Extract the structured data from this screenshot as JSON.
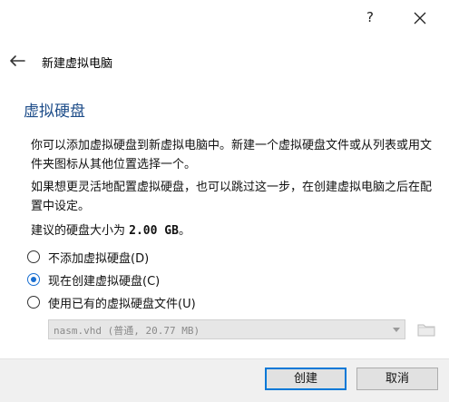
{
  "titlebar": {
    "help_label": "?"
  },
  "header": {
    "title": "新建虚拟电脑"
  },
  "page": {
    "title": "虚拟硬盘",
    "para1": "你可以添加虚拟硬盘到新虚拟电脑中。新建一个虚拟硬盘文件或从列表或用文件夹图标从其他位置选择一个。",
    "para2": "如果想更灵活地配置虚拟硬盘，也可以跳过这一步，在创建虚拟电脑之后在配置中设定。",
    "size_prefix": "建议的硬盘大小为",
    "size_value": "2.00 GB",
    "size_suffix": "。"
  },
  "options": [
    {
      "label": "不添加虚拟硬盘(D)",
      "checked": false
    },
    {
      "label": "现在创建虚拟硬盘(C)",
      "checked": true
    },
    {
      "label": "使用已有的虚拟硬盘文件(U)",
      "checked": false
    }
  ],
  "existing_disk": {
    "selected": "nasm.vhd (普通, 20.77 MB)"
  },
  "buttons": {
    "create": "创建",
    "cancel": "取消"
  },
  "icons": {
    "back": "back-arrow-icon",
    "close": "close-icon",
    "folder": "folder-icon",
    "dropdown": "chevron-down-icon"
  },
  "colors": {
    "accent": "#1a6fd1",
    "title": "#1f4e8a",
    "default_button_border": "#0078d7"
  }
}
